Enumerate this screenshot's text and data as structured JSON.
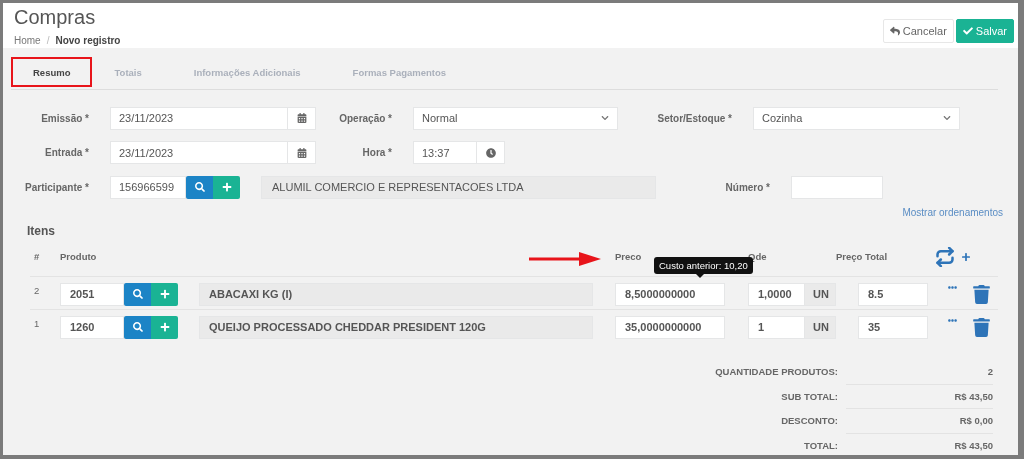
{
  "header": {
    "title": "Compras",
    "breadcrumb_separator": "/",
    "breadcrumb": [
      {
        "label": "Home",
        "current": false
      },
      {
        "label": "Novo registro",
        "current": true
      }
    ],
    "buttons": [
      {
        "label": "Cancelar",
        "kind": "default"
      },
      {
        "label": "Salvar",
        "kind": "primary"
      }
    ]
  },
  "tabs": [
    {
      "label": "Resumo",
      "selected": true,
      "highlighted": true
    },
    {
      "label": "Totais",
      "selected": false,
      "highlighted": false
    },
    {
      "label": "Informações Adicionais",
      "selected": false,
      "highlighted": false
    },
    {
      "label": "Formas Pagamentos",
      "selected": false,
      "highlighted": false
    }
  ],
  "form": {
    "emissao": {
      "label": "Emissão *",
      "value": "23/11/2023"
    },
    "operacao": {
      "label": "Operação *",
      "value": "Normal"
    },
    "setor": {
      "label": "Setor/Estoque *",
      "value": "Cozinha"
    },
    "entrada": {
      "label": "Entrada *",
      "value": "23/11/2023"
    },
    "hora": {
      "label": "Hora *",
      "value": "13:37"
    },
    "participante": {
      "label": "Participante *",
      "value": "156966599",
      "name": "ALUMIL COMERCIO E REPRESENTACOES LTDA"
    },
    "numero": {
      "label": "Número *"
    }
  },
  "items": {
    "title": "Itens",
    "link": "Mostrar ordenamentos",
    "columns": {
      "index": "#",
      "product": "Produto",
      "price": "Preco",
      "qty": "Qde",
      "total": "Preço Total"
    },
    "tooltip": "Custo anterior: 10,20",
    "arrow_annotation": true,
    "rows": [
      {
        "index": "2",
        "code": "2051",
        "name": "ABACAXI KG (I)",
        "price": "8,5000000000",
        "qty": "1,0000",
        "unit": "UN",
        "total": "8.5"
      },
      {
        "index": "1",
        "code": "1260",
        "name": "QUEIJO PROCESSADO CHEDDAR PRESIDENT 120G",
        "price": "35,0000000000",
        "qty": "1",
        "unit": "UN",
        "total": "35"
      }
    ]
  },
  "summary": [
    {
      "label": "QUANTIDADE PRODUTOS:",
      "value": "2"
    },
    {
      "label": "SUB TOTAL:",
      "value": "R$ 43,50"
    },
    {
      "label": "DESCONTO:",
      "value": "R$ 0,00"
    },
    {
      "label": "TOTAL:",
      "value": "R$ 43,50"
    }
  ]
}
